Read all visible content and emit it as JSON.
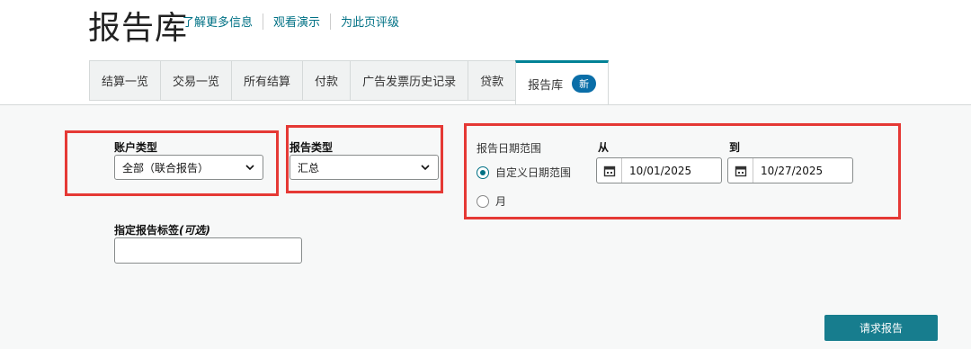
{
  "header": {
    "title": "报告库",
    "links": [
      "了解更多信息",
      "观看演示",
      "为此页评级"
    ]
  },
  "tabs": [
    {
      "label": "结算一览"
    },
    {
      "label": "交易一览"
    },
    {
      "label": "所有结算"
    },
    {
      "label": "付款"
    },
    {
      "label": "广告发票历史记录"
    },
    {
      "label": "贷款"
    },
    {
      "label": "报告库",
      "badge": "新",
      "active": true
    }
  ],
  "form": {
    "account_type": {
      "label": "账户类型",
      "value": "全部（联合报告）"
    },
    "report_type": {
      "label": "报告类型",
      "value": "汇总"
    },
    "date_range": {
      "label": "报告日期范围",
      "from_label": "从",
      "to_label": "到",
      "options": [
        {
          "label": "自定义日期范围",
          "checked": true
        },
        {
          "label": "月",
          "checked": false
        }
      ],
      "from_value": "10/01/2025",
      "to_value": "10/27/2025"
    },
    "report_tag": {
      "label": "指定报告标签",
      "optional": "(可选)",
      "value": ""
    },
    "submit_label": "请求报告"
  },
  "colors": {
    "accent": "#007185",
    "button": "#177d8e",
    "highlight": "#e53935",
    "badge": "#0a6ea8"
  }
}
